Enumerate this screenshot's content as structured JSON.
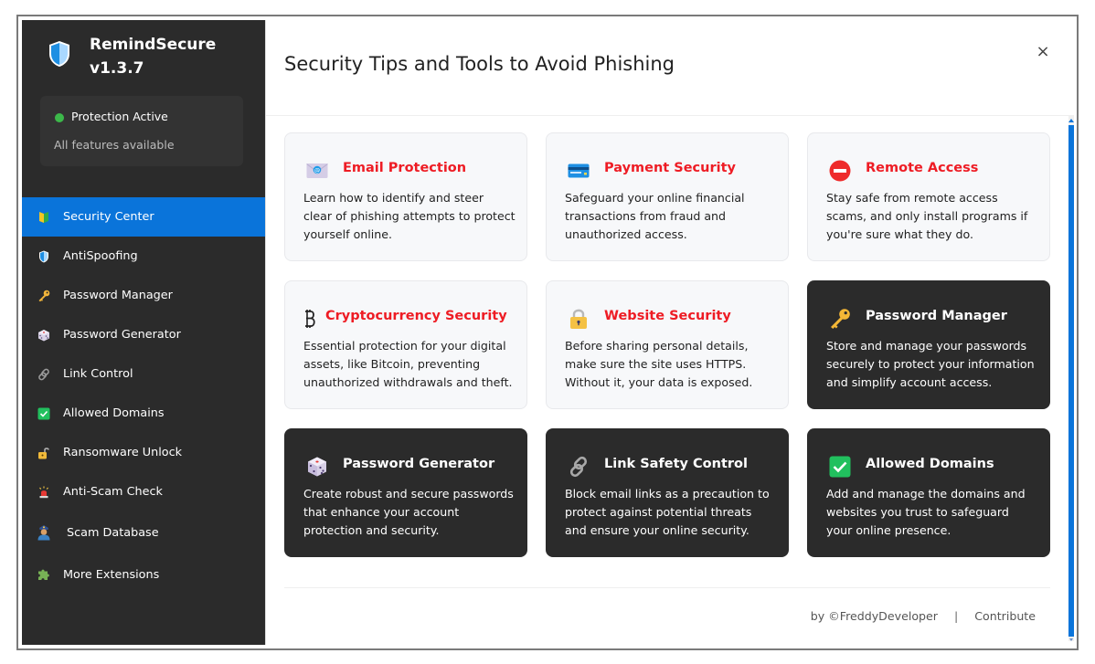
{
  "app": {
    "name": "RemindSecure",
    "version": "v1.3.7"
  },
  "status": {
    "title": "Protection Active",
    "subtitle": "All features available",
    "color": "#3cb84a"
  },
  "sidebar": {
    "active_index": 0,
    "items": [
      {
        "label": "Security Center",
        "icon": "beginner-shield-icon"
      },
      {
        "label": "AntiSpoofing",
        "icon": "shield-icon"
      },
      {
        "label": "Password Manager",
        "icon": "key-icon"
      },
      {
        "label": "Password Generator",
        "icon": "dice-icon"
      },
      {
        "label": "Link Control",
        "icon": "link-icon"
      },
      {
        "label": "Allowed Domains",
        "icon": "check-box-icon"
      },
      {
        "label": "Ransomware Unlock",
        "icon": "unlock-icon"
      },
      {
        "label": "Anti-Scam Check",
        "icon": "siren-icon"
      },
      {
        "label": "Scam Database",
        "icon": "police-officer-icon"
      },
      {
        "label": "More Extensions",
        "icon": "puzzle-icon"
      }
    ]
  },
  "header": {
    "title": "Security Tips and Tools to Avoid Phishing",
    "close_label": "×"
  },
  "cards": [
    {
      "title": "Email Protection",
      "icon": "email-icon",
      "theme": "light",
      "description": "Learn how to identify and steer clear of phishing attempts to protect yourself online."
    },
    {
      "title": "Payment Security",
      "icon": "credit-card-icon",
      "theme": "light",
      "description": "Safeguard your online financial transactions from fraud and unauthorized access."
    },
    {
      "title": "Remote Access",
      "icon": "no-entry-icon",
      "theme": "light",
      "description": "Stay safe from remote access scams, and only install programs if you're sure what they do."
    },
    {
      "title": "Cryptocurrency Security",
      "icon": "bitcoin-icon",
      "theme": "light",
      "description": "Essential protection for your digital assets, like Bitcoin, preventing unauthorized withdrawals and theft."
    },
    {
      "title": "Website Security",
      "icon": "lock-icon",
      "theme": "light",
      "description": "Before sharing personal details, make sure the site uses HTTPS. Without it, your data is exposed."
    },
    {
      "title": "Password Manager",
      "icon": "key-icon",
      "theme": "dark",
      "description": "Store and manage your passwords securely to protect your information and simplify account access."
    },
    {
      "title": "Password Generator",
      "icon": "dice-icon",
      "theme": "dark",
      "description": "Create robust and secure passwords that enhance your account protection and security."
    },
    {
      "title": "Link Safety Control",
      "icon": "link-icon",
      "theme": "dark",
      "description": "Block email links as a precaution to protect against potential threats and ensure your online security."
    },
    {
      "title": "Allowed Domains",
      "icon": "check-box-icon",
      "theme": "dark",
      "description": "Add and manage the domains and websites you trust to safeguard your online presence."
    }
  ],
  "footer": {
    "credit": "by ©FreddyDeveloper",
    "separator": "|",
    "contribute": "Contribute"
  },
  "colors": {
    "accent": "#0a74da",
    "sidebar_bg": "#2b2b2b",
    "tip_title": "#ee1c24",
    "status_green": "#3cb84a"
  }
}
